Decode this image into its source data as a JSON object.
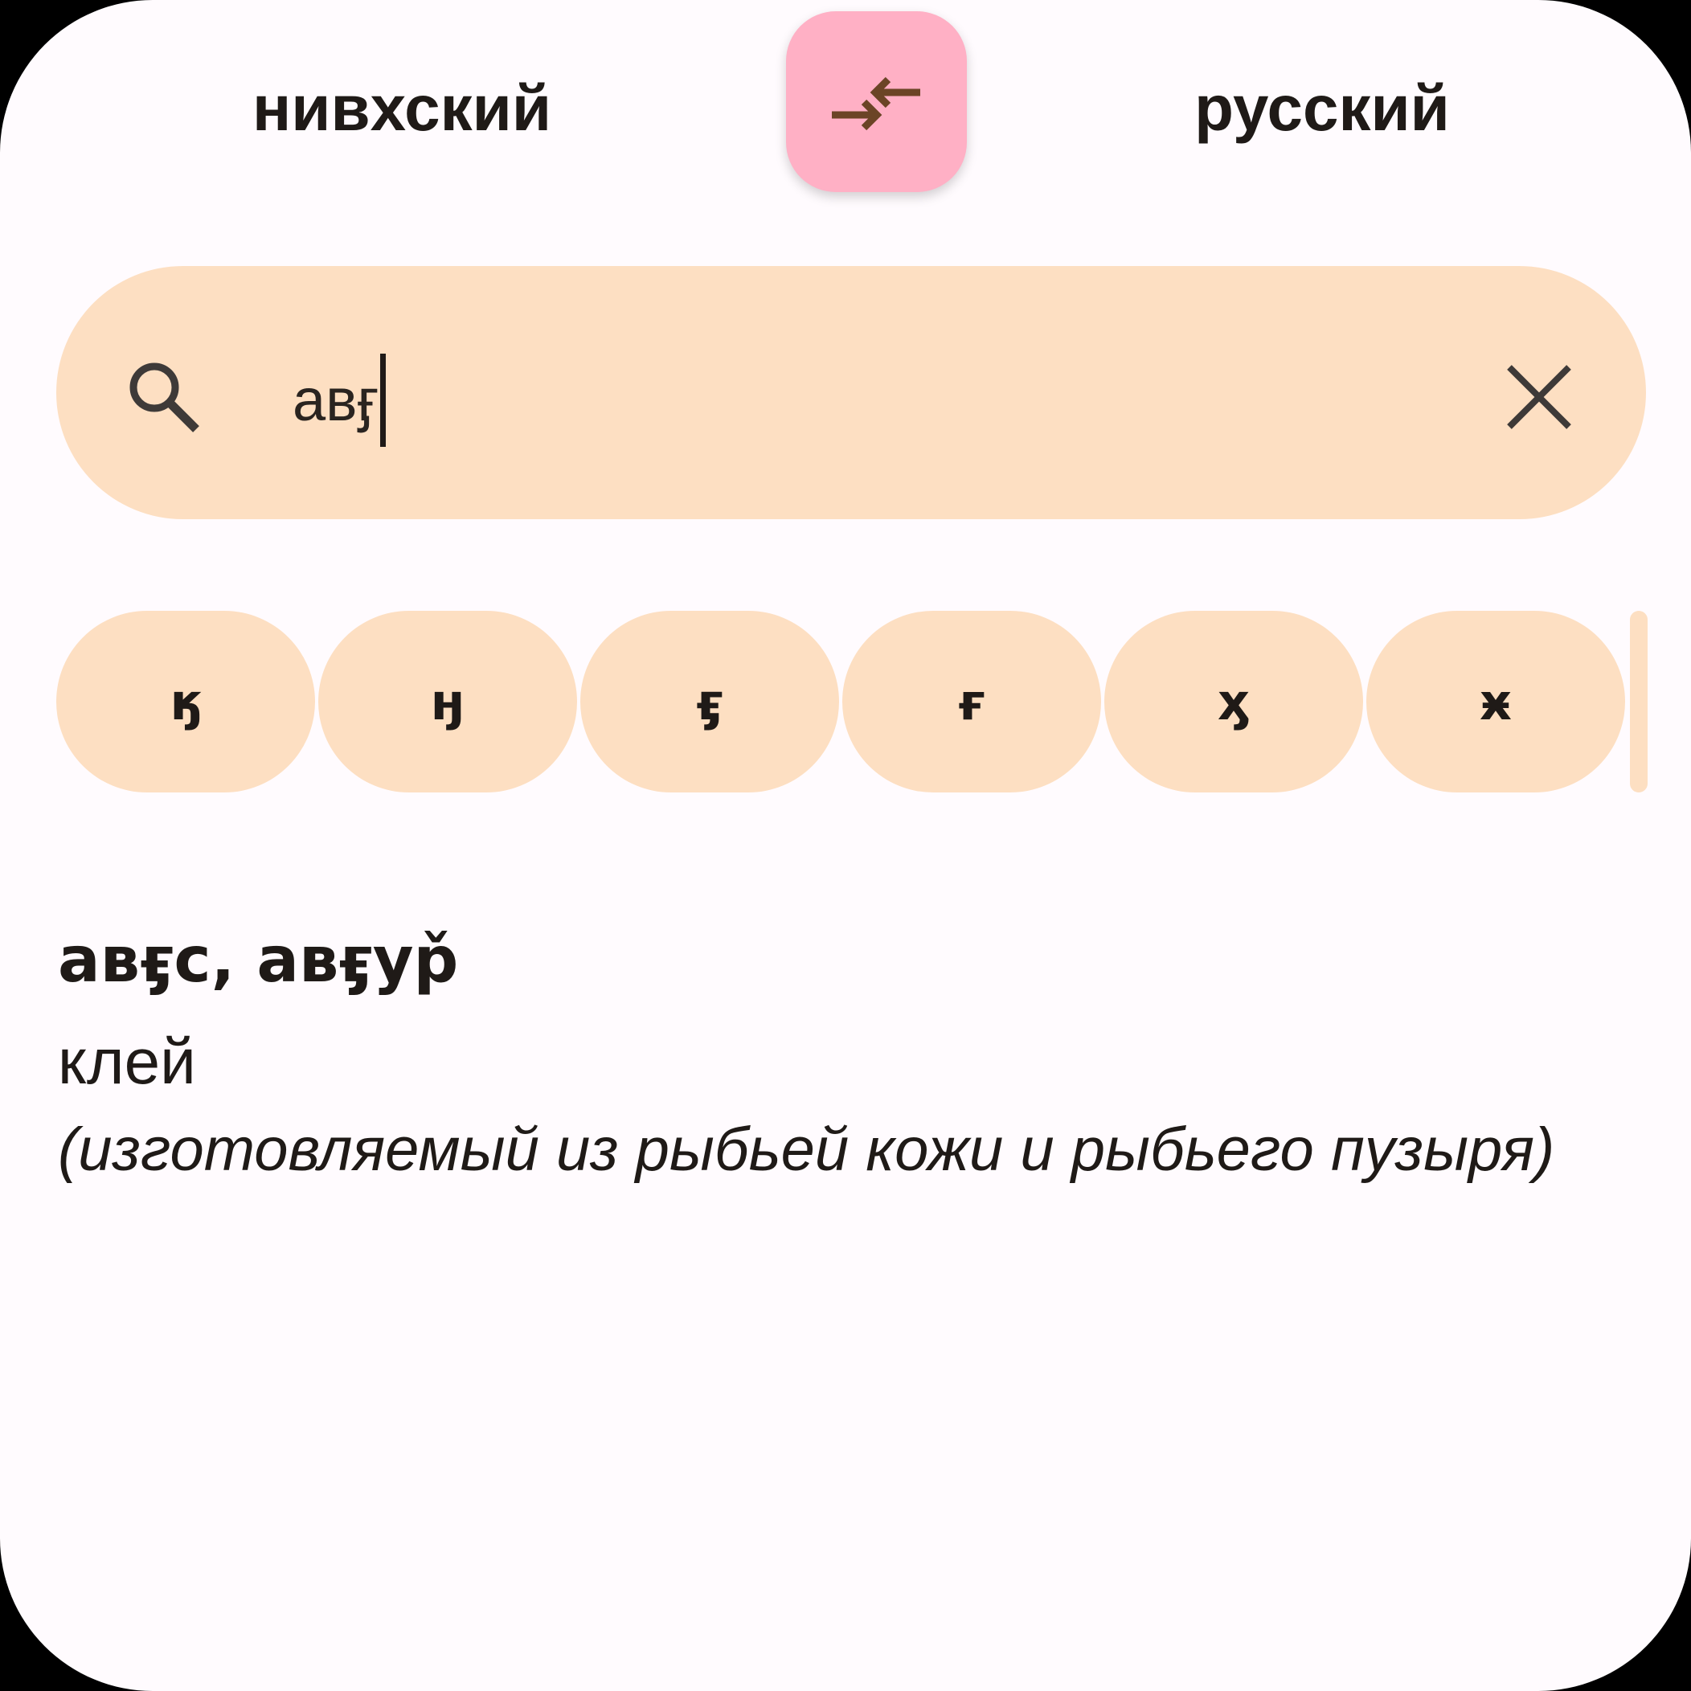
{
  "header": {
    "source_language": "нивхский",
    "target_language": "русский",
    "swap_icon": "swap-arrows-icon"
  },
  "search": {
    "icon": "search-icon",
    "value": "авӻ",
    "clear_icon": "close-icon"
  },
  "letters": [
    "ӄ",
    "ӈ",
    "ӻ",
    "ғ",
    "ӽ",
    "ӿ"
  ],
  "entry": {
    "headword": "авӻс, авӻур̌",
    "translation": "клей",
    "note": "(изготовляемый из рыбьей кожи и рыбьего пузыря)"
  },
  "colors": {
    "background": "#FFFBFE",
    "surface": "#FDDFC2",
    "swap_button": "#FFB0C5",
    "accent": "#6B4426",
    "text": "#1F1A17"
  }
}
